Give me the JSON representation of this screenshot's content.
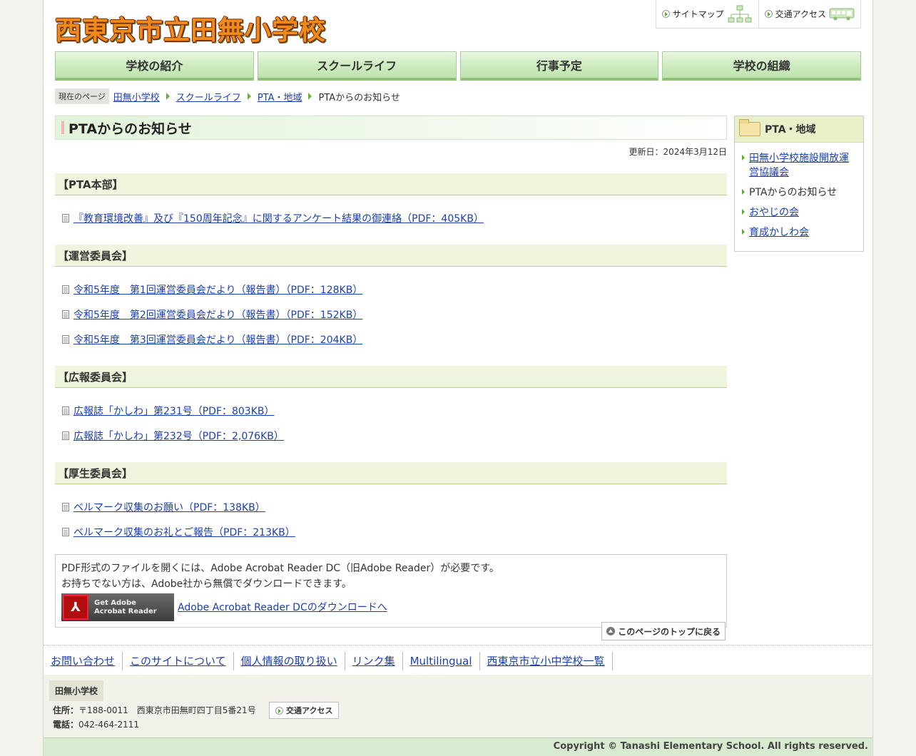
{
  "header": {
    "logo_text": "西東京市立田無小学校",
    "sitemap": "サイトマップ",
    "access": "交通アクセス"
  },
  "gnav": [
    "学校の紹介",
    "スクールライフ",
    "行事予定",
    "学校の組織"
  ],
  "breadcrumb": {
    "here": "現在のページ",
    "items": [
      "田無小学校",
      "スクールライフ",
      "PTA・地域"
    ],
    "current": "PTAからのお知らせ"
  },
  "main": {
    "title": "PTAからのお知らせ",
    "updated": "更新日：2024年3月12日",
    "sections": [
      {
        "heading": "【PTA本部】",
        "files": [
          "『教育環境改善』及び『150周年記念』に関するアンケート結果の御連絡（PDF：405KB）"
        ]
      },
      {
        "heading": "【運営委員会】",
        "files": [
          "令和5年度　第1回運営委員会だより（報告書）（PDF：128KB）",
          "令和5年度　第2回運営委員会だより（報告書）（PDF：152KB）",
          "令和5年度　第3回運営委員会だより（報告書）（PDF：204KB）"
        ]
      },
      {
        "heading": "【広報委員会】",
        "files": [
          "広報誌「かしわ」第231号（PDF：803KB）",
          "広報誌「かしわ」第232号（PDF：2,076KB）"
        ]
      },
      {
        "heading": "【厚生委員会】",
        "files": [
          "ベルマーク収集のお願い（PDF：138KB）",
          "ベルマーク収集のお礼とご報告（PDF：213KB）"
        ]
      }
    ],
    "pdf_note": {
      "line1": "PDF形式のファイルを開くには、Adobe Acrobat Reader DC（旧Adobe Reader）が必要です。",
      "line2": "お持ちでない方は、Adobe社から無償でダウンロードできます。",
      "badge_line1": "Get Adobe",
      "badge_line2": "Acrobat Reader",
      "link": "Adobe Acrobat Reader DCのダウンロードへ"
    },
    "pagetop": "このページのトップに戻る"
  },
  "sidebar": {
    "heading": "PTA・地域",
    "items": [
      {
        "label": "田無小学校施設開放運営協議会",
        "link": true
      },
      {
        "label": "PTAからのお知らせ",
        "link": false
      },
      {
        "label": "おやじの会",
        "link": true
      },
      {
        "label": "育成かしわ会",
        "link": true
      }
    ]
  },
  "footer": {
    "links": [
      "お問い合わせ",
      "このサイトについて",
      "個人情報の取り扱い",
      "リンク集",
      "Multilingual",
      "西東京市立小中学校一覧"
    ],
    "school_name": "田無小学校",
    "address_label": "住所：",
    "address": "〒188-0011　西東京市田無町四丁目5番21号",
    "phone_label": "電話：",
    "phone": "042-464-2111",
    "access": "交通アクセス",
    "copyright": "Copyright © Tanashi Elementary School. All rights reserved."
  },
  "colors": {
    "link": "#1a3fb0",
    "nav_green": "#cdebbf",
    "section_bg": "#eff5dc",
    "accent_green": "#58a832"
  }
}
